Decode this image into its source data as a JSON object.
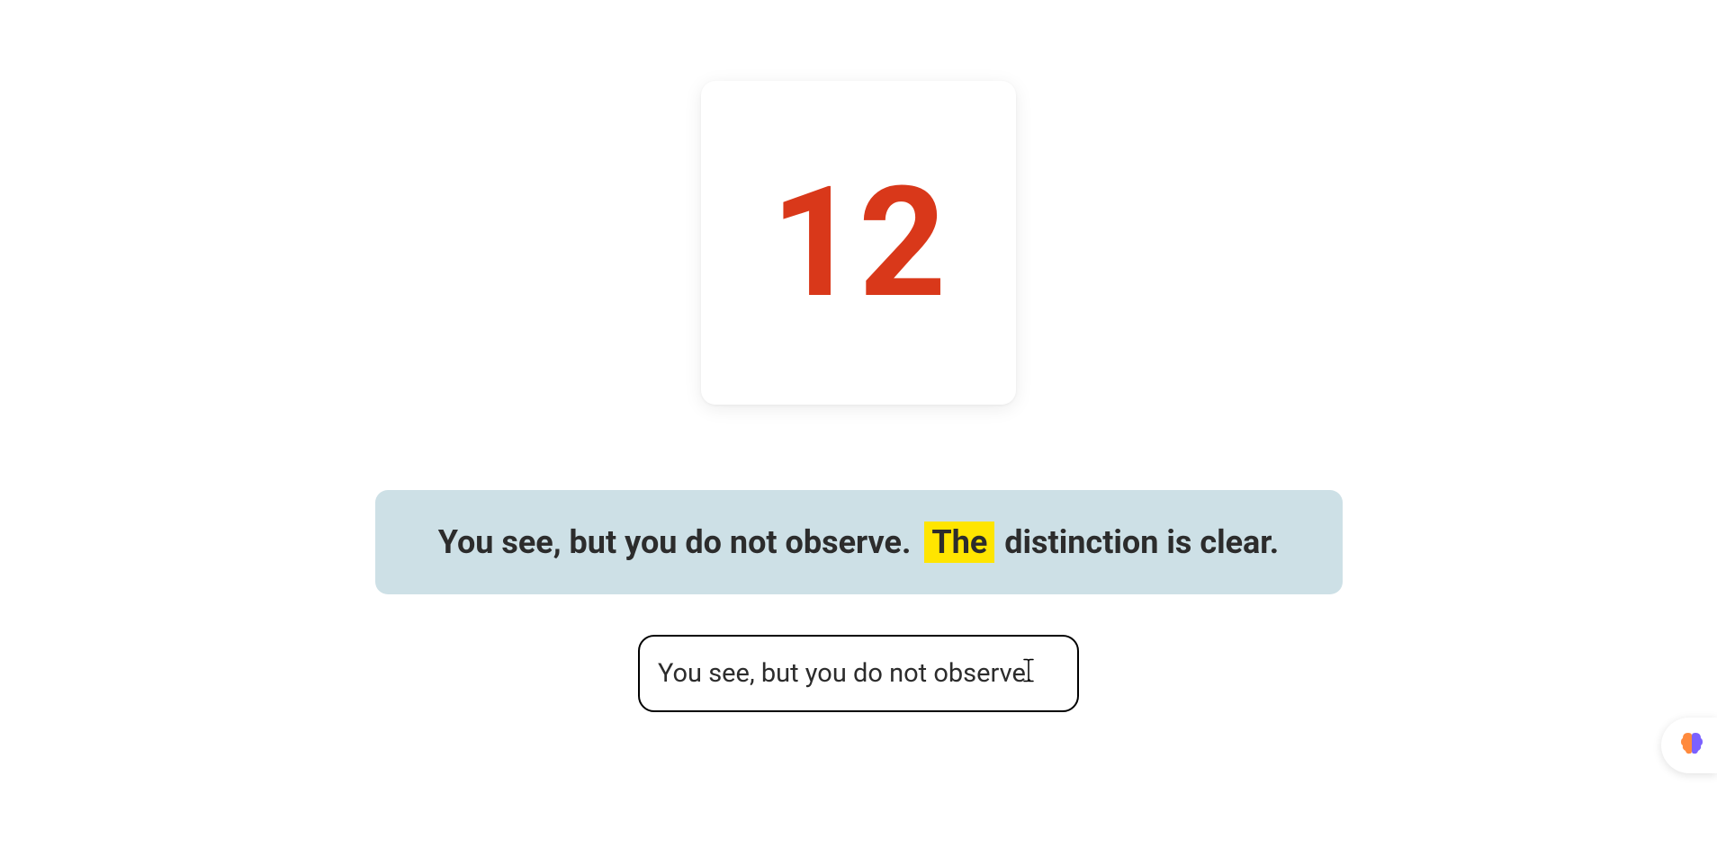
{
  "timer": {
    "value": "12"
  },
  "sentence": {
    "before": "You see, but you do not observe. ",
    "highlighted": "The",
    "after": " distinction is clear."
  },
  "input": {
    "value": "You see, but you do not observe. "
  }
}
